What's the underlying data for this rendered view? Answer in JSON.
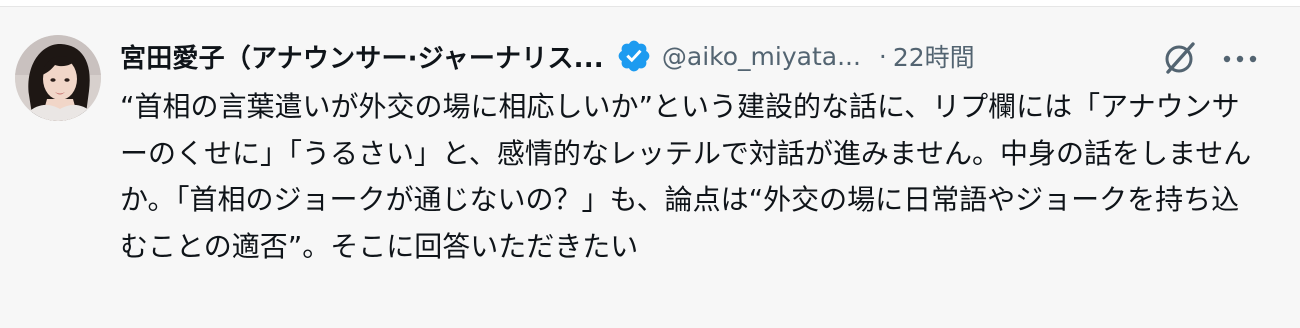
{
  "tweet": {
    "author_name": "宮田愛子（アナウンサー·ジャーナリス...",
    "handle": "@aiko_miyata...",
    "separator": "·",
    "timestamp": "22時間",
    "text": "“首相の言葉遣いが外交の場に相応しいか”という建設的な話に、リプ欄には「アナウンサーのくせに」「うるさい」と、感情的なレッテルで対話が進みません。中身の話をしませんか。「首相のジョークが通じないの？」も、論点は“外交の場に日常語やジョークを持ち込むことの適否”。そこに回答いただきたい"
  },
  "icons": {
    "avatar": "avatar-photo",
    "verified": "verified-badge-icon",
    "grok": "grok-icon",
    "more": "more-options-icon"
  },
  "colors": {
    "background": "#f7f7f7",
    "text_primary": "#0f1419",
    "text_secondary": "#536471",
    "verified_blue": "#1d9bf0"
  }
}
